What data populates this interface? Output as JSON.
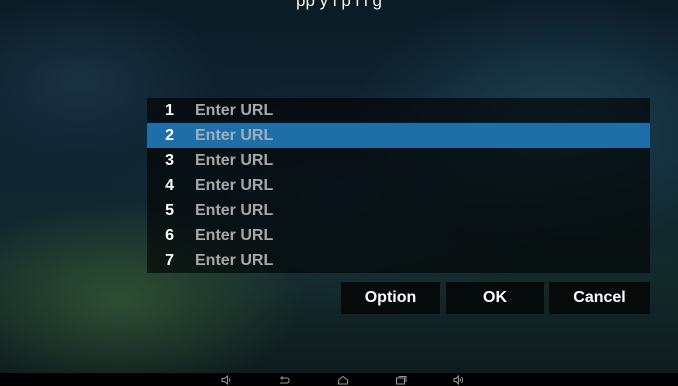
{
  "header": {
    "partial_text": "pp y   l                   p     l                     l   g  "
  },
  "url_list": {
    "selected_index": 1,
    "placeholder": "Enter URL",
    "rows": [
      {
        "number": "1",
        "value": "Enter URL"
      },
      {
        "number": "2",
        "value": "Enter URL"
      },
      {
        "number": "3",
        "value": "Enter URL"
      },
      {
        "number": "4",
        "value": "Enter URL"
      },
      {
        "number": "5",
        "value": "Enter URL"
      },
      {
        "number": "6",
        "value": "Enter URL"
      },
      {
        "number": "7",
        "value": "Enter URL"
      }
    ]
  },
  "buttons": {
    "option_label": "Option",
    "ok_label": "OK",
    "cancel_label": "Cancel"
  },
  "nav_bar": {
    "icons": [
      "volume-down-icon",
      "back-icon",
      "home-icon",
      "recent-apps-icon",
      "volume-up-icon"
    ]
  },
  "colors": {
    "selection": "#1e6fa8",
    "url_text": "#a8a8a8",
    "number_text": "#ffffff"
  }
}
